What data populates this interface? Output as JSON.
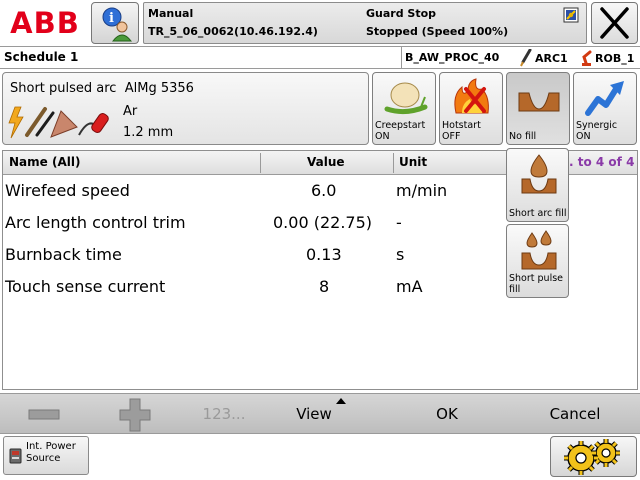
{
  "header": {
    "mode": "Manual",
    "controller": "TR_5_06_0062(10.46.192.4)",
    "state": "Guard Stop",
    "state_detail": "Stopped (Speed 100%)",
    "logo": "ABB"
  },
  "schedule": {
    "title": "Schedule 1",
    "process": "B_AW_PROC_40",
    "arc": "ARC1",
    "robot": "ROB_1"
  },
  "weld": {
    "process_name": "Short pulsed arc",
    "material": "AlMg 5356",
    "gas": "Ar",
    "wire": "1.2 mm"
  },
  "options": [
    {
      "label_line1": "Creepstart",
      "label_line2": "ON"
    },
    {
      "label_line1": "Hotstart",
      "label_line2": "OFF"
    },
    {
      "label_line1": "No fill",
      "label_line2": ""
    },
    {
      "label_line1": "Synergic",
      "label_line2": "ON"
    }
  ],
  "fill_menu": [
    {
      "label_line1": "Short arc fill",
      "label_line2": ""
    },
    {
      "label_line1": "Short pulse",
      "label_line2": "fill"
    }
  ],
  "table": {
    "headers": {
      "name": "Name (All)",
      "value": "Value",
      "unit": "Unit"
    },
    "page_info": ". to 4 of 4",
    "rows": [
      {
        "name": "Wirefeed speed",
        "value": "6.0",
        "unit": "m/min"
      },
      {
        "name": "Arc length control trim",
        "value": "0.00 (22.75)",
        "unit": "-"
      },
      {
        "name": "Burnback time",
        "value": "0.13",
        "unit": "s"
      },
      {
        "name": "Touch sense current",
        "value": "8",
        "unit": "mA"
      }
    ]
  },
  "commands": {
    "keypad": "123...",
    "view": "View",
    "ok": "OK",
    "cancel": "Cancel"
  },
  "footer": {
    "power_line1": "Int. Power",
    "power_line2": "Source"
  },
  "colors": {
    "brand_red": "#e2001a",
    "page_info": "#8a3aa8"
  }
}
